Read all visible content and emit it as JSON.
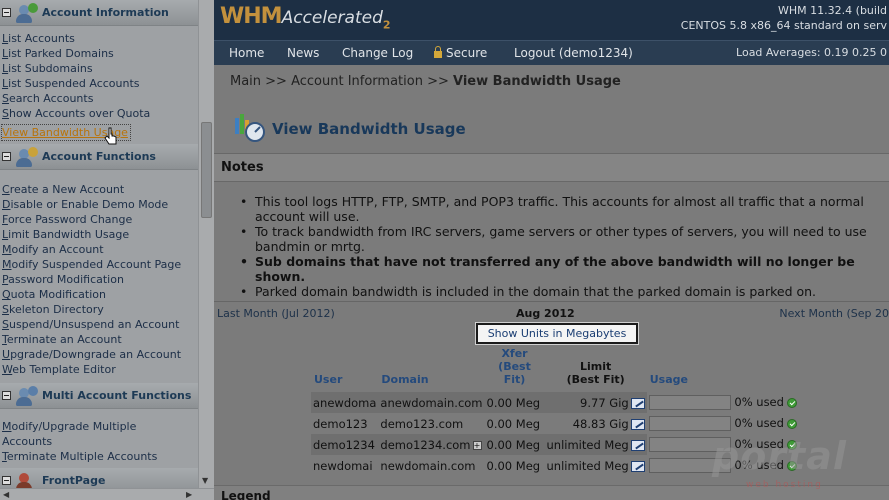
{
  "sidebar": {
    "sections": [
      {
        "title": "Account Information",
        "items": [
          {
            "first": "L",
            "rest": "ist Accounts"
          },
          {
            "first": "L",
            "rest": "ist Parked Domains"
          },
          {
            "first": "L",
            "rest": "ist Subdomains"
          },
          {
            "first": "L",
            "rest": "ist Suspended Accounts"
          },
          {
            "first": "S",
            "rest": "earch Accounts"
          },
          {
            "first": "S",
            "rest": "how Accounts over Quota"
          },
          {
            "first": "V",
            "rest": "iew Bandwidth Usage"
          }
        ]
      },
      {
        "title": "Account Functions",
        "items": [
          {
            "first": "C",
            "rest": "reate a New Account"
          },
          {
            "first": "D",
            "rest": "isable or Enable Demo Mode"
          },
          {
            "first": "F",
            "rest": "orce Password Change"
          },
          {
            "first": "L",
            "rest": "imit Bandwidth Usage"
          },
          {
            "first": "M",
            "rest": "odify an Account"
          },
          {
            "first": "M",
            "rest": "odify Suspended Account Page"
          },
          {
            "first": "P",
            "rest": "assword Modification"
          },
          {
            "first": "Q",
            "rest": "uota Modification"
          },
          {
            "first": "S",
            "rest": "keleton Directory"
          },
          {
            "first": "S",
            "rest": "uspend/Unsuspend an Account"
          },
          {
            "first": "T",
            "rest": "erminate an Account"
          },
          {
            "first": "U",
            "rest": "pgrade/Downgrade an Account"
          },
          {
            "first": "W",
            "rest": "eb Template Editor"
          }
        ]
      },
      {
        "title": "Multi Account Functions",
        "items": [
          {
            "first": "M",
            "rest": "odify/Upgrade Multiple"
          },
          {
            "first": "",
            "rest": "Accounts"
          },
          {
            "first": "T",
            "rest": "erminate Multiple Accounts"
          }
        ]
      },
      {
        "title": "FrontPage",
        "items": []
      }
    ]
  },
  "header": {
    "logo_main": "WHM",
    "logo_accent": "Accelerated",
    "logo_version": "2",
    "version_line": "WHM 11.32.4 (build",
    "os_line": "CENTOS 5.8 x86_64 standard on serv"
  },
  "nav": {
    "home": "Home",
    "news": "News",
    "changelog": "Change Log",
    "secure": "Secure",
    "logout": "Logout (demo1234)",
    "load_averages": "Load Averages: 0.19 0.25 0"
  },
  "main": {
    "breadcrumb_path": "Main >> Account Information >> ",
    "breadcrumb_current": "View Bandwidth Usage",
    "page_title": "View Bandwidth Usage",
    "notes_title": "Notes",
    "notes": [
      {
        "text": "This tool logs HTTP, FTP, SMTP, and POP3 traffic. This accounts for almost all traffic that a normal account will use.",
        "bold": false
      },
      {
        "text": "To track bandwidth from IRC servers, game servers or other types of servers, you will need to use bandmin or mrtg.",
        "bold": false
      },
      {
        "text": "Sub domains that have not transferred any of the above bandwidth will no longer be shown.",
        "bold": true
      },
      {
        "text": "Parked domain bandwidth is included in the domain that the parked domain is parked on.",
        "bold": false
      }
    ],
    "last_month": "Last Month (Jul 2012)",
    "current_month": "Aug 2012",
    "next_month": "Next Month (Sep 20",
    "units_button": "Show Units in Megabytes",
    "legend_title": "Legend"
  },
  "table": {
    "headers": {
      "user": "User",
      "domain": "Domain",
      "xfer_1": "Xfer",
      "xfer_2": "(Best Fit)",
      "limit_1": "Limit",
      "limit_2": "(Best Fit)",
      "usage": "Usage"
    },
    "rows": [
      {
        "user": "anewdoma",
        "domain": "anewdomain.com",
        "xfer": "0.00 Meg",
        "limit": "9.77 Gig",
        "usage": "0% used"
      },
      {
        "user": "demo123",
        "domain": "demo123.com",
        "xfer": "0.00 Meg",
        "limit": "48.83 Gig",
        "usage": "0% used"
      },
      {
        "user": "demo1234",
        "domain": "demo1234.com",
        "xfer": "0.00 Meg",
        "limit": "unlimited Meg",
        "usage": "0% used"
      },
      {
        "user": "newdomai",
        "domain": "newdomain.com",
        "xfer": "0.00 Meg",
        "limit": "unlimited Meg",
        "usage": "0% used"
      }
    ]
  },
  "watermark": {
    "brand": "portal",
    "sub": "web hosting"
  }
}
